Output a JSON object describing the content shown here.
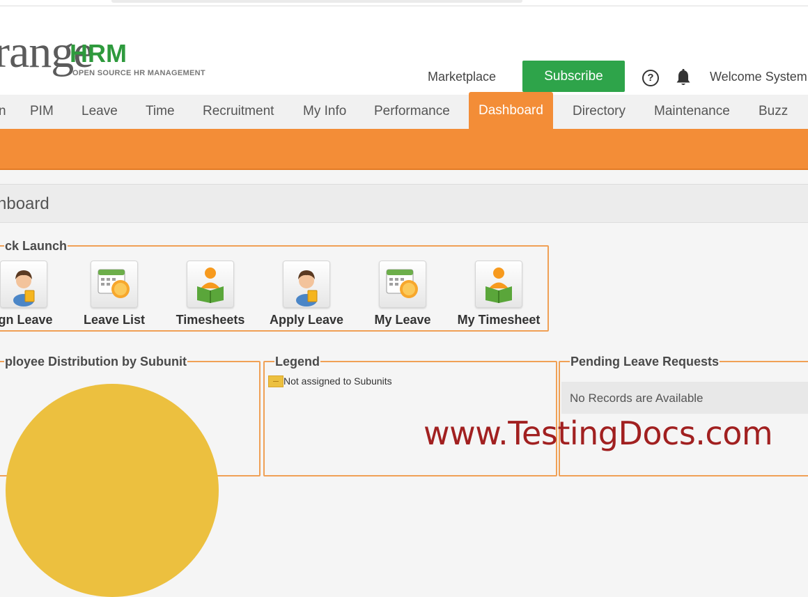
{
  "logo": {
    "main": "range",
    "hrm": "HRM",
    "tagline": "OPEN SOURCE HR MANAGEMENT"
  },
  "header": {
    "marketplace": "Marketplace",
    "subscribe": "Subscribe",
    "help_icon": "question-circle-icon",
    "help_glyph": "?",
    "bell_icon": "bell-icon",
    "welcome": "Welcome System"
  },
  "nav": {
    "items": [
      {
        "label": "n"
      },
      {
        "label": "PIM"
      },
      {
        "label": "Leave"
      },
      {
        "label": "Time"
      },
      {
        "label": "Recruitment"
      },
      {
        "label": "My Info"
      },
      {
        "label": "Performance"
      },
      {
        "label": "Dashboard",
        "active": true
      },
      {
        "label": "Directory"
      },
      {
        "label": "Maintenance"
      },
      {
        "label": "Buzz"
      }
    ]
  },
  "page": {
    "title": "hboard"
  },
  "quick_launch": {
    "title": "ck Launch",
    "items": [
      {
        "label": "ign Leave",
        "icon": "assign-leave-icon"
      },
      {
        "label": "Leave List",
        "icon": "leave-list-icon"
      },
      {
        "label": "Timesheets",
        "icon": "timesheets-icon"
      },
      {
        "label": "Apply Leave",
        "icon": "apply-leave-icon"
      },
      {
        "label": "My Leave",
        "icon": "my-leave-icon"
      },
      {
        "label": "My Timesheet",
        "icon": "my-timesheet-icon"
      }
    ]
  },
  "employee_distribution": {
    "title": "ployee Distribution by Subunit"
  },
  "legend": {
    "title": "Legend",
    "items": [
      {
        "label": "Not assigned to Subunits",
        "color": "#ecc03f"
      }
    ]
  },
  "pending_leave": {
    "title": "Pending Leave Requests",
    "empty_text": "No Records are Available"
  },
  "watermark": "www.TestingDocs.com",
  "colors": {
    "accent": "#f38d37",
    "subscribe": "#2ea44a",
    "brand_green": "#2e9a3d",
    "pie": "#ecc03f",
    "watermark": "#a12020"
  }
}
